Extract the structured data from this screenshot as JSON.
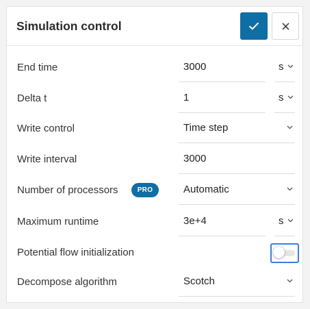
{
  "header": {
    "title": "Simulation control"
  },
  "rows": [
    {
      "label": "End time",
      "value": "3000",
      "unit": "s"
    },
    {
      "label": "Delta t",
      "value": "1",
      "unit": "s"
    },
    {
      "label": "Write control",
      "value": "Time step"
    },
    {
      "label": "Write interval",
      "value": "3000"
    },
    {
      "label": "Number of processors",
      "badge": "PRO",
      "value": "Automatic"
    },
    {
      "label": "Maximum runtime",
      "value": "3e+4",
      "unit": "s"
    },
    {
      "label": "Potential flow initialization",
      "toggle_on": false
    },
    {
      "label": "Decompose algorithm",
      "value": "Scotch"
    }
  ],
  "colors": {
    "accent": "#0f6ea3",
    "focus_outline": "#3b7fd9"
  },
  "icons": {
    "confirm": "check-icon",
    "close": "close-icon",
    "dropdown": "chevron-down-icon"
  }
}
